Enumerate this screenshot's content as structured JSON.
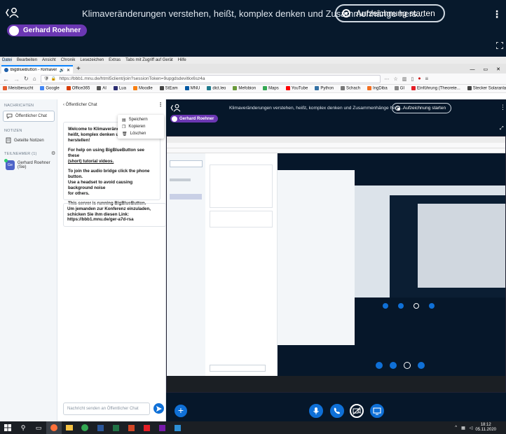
{
  "outer": {
    "title": "Klimaveränderungen verstehen, heißt, komplex denken und Zusammenhänge hers...",
    "record_label": "Aufzeichnung starten",
    "presenter": "Gerhard Roehner"
  },
  "browser": {
    "menu": [
      "Datei",
      "Bearbeiten",
      "Ansicht",
      "Chronik",
      "Lesezeichen",
      "Extras",
      "Tabs mit Zugriff auf Gerät",
      "Hilfe"
    ],
    "tab_title": "BigBlueButton - Klimaverä",
    "url": "https://bbb1.mnu.de/html5client/join?sessionToken=9upgdsdevitkx6sz4a",
    "bookmarks": [
      "Meistbesucht",
      "Google",
      "Office365",
      "AI",
      "Lua",
      "Moodle",
      "StEam",
      "MNU",
      "dict.leo",
      "Mefobion",
      "Maps",
      "YouTube",
      "Python",
      "Schach",
      "IngDiba",
      "GI",
      "Einführung (Theorete...",
      "Stecker Solaranlagen:..."
    ],
    "bookmark_colors": [
      "#e55b2b",
      "#4285f4",
      "#d83b01",
      "#555555",
      "#2c2d72",
      "#f98012",
      "#444444",
      "#0058a3",
      "#1f7a8c",
      "#6a9a3a",
      "#34a853",
      "#ff0000",
      "#3572a5",
      "#777777",
      "#f36f21",
      "#888888",
      "#e41e26",
      "#444444"
    ]
  },
  "sidebar": {
    "messages_header": "NACHRICHTEN",
    "public_chat": "Öffentlicher Chat",
    "notes_header": "NOTIZEN",
    "shared_notes": "Geteilte Notizen",
    "participants_header": "TEILNEHMER (1)",
    "participant_name": "Gerhard Roehner (Sie)",
    "participant_avatar": "Ge"
  },
  "chat": {
    "header": "Öffentlicher Chat",
    "welcome_lines": [
      "Welcome to Klimaveränder",
      "heißt, komplex denken und",
      "herstellen!"
    ],
    "help_lines": [
      "For help on using BigBlueButton see these",
      "(short) tutorial videos."
    ],
    "audio_lines": [
      "To join the audio bridge click the phone button.",
      "Use a headset to avoid causing background noise",
      "for others."
    ],
    "running": "This server is running BigBlueButton.",
    "invite_lines": [
      "Um jemanden zur Konferenz einzuladen,",
      "schicken Sie ihm diesen Link:",
      "https://bbb1.mnu.de/ger-a7d-rsa"
    ],
    "placeholder": "Nachricht senden an Öffentlicher Chat"
  },
  "chat_menu": [
    "Speichern",
    "Kopieren",
    "Löschen"
  ],
  "meeting": {
    "title": "Klimaveränderungen verstehen, heißt, komplex denken und Zusammenhänge herst...",
    "record_label": "Aufzeichnung starten",
    "presenter": "Gerhard Roehner"
  },
  "taskbar": {
    "time": "18:12",
    "date": "05.11.2020"
  }
}
